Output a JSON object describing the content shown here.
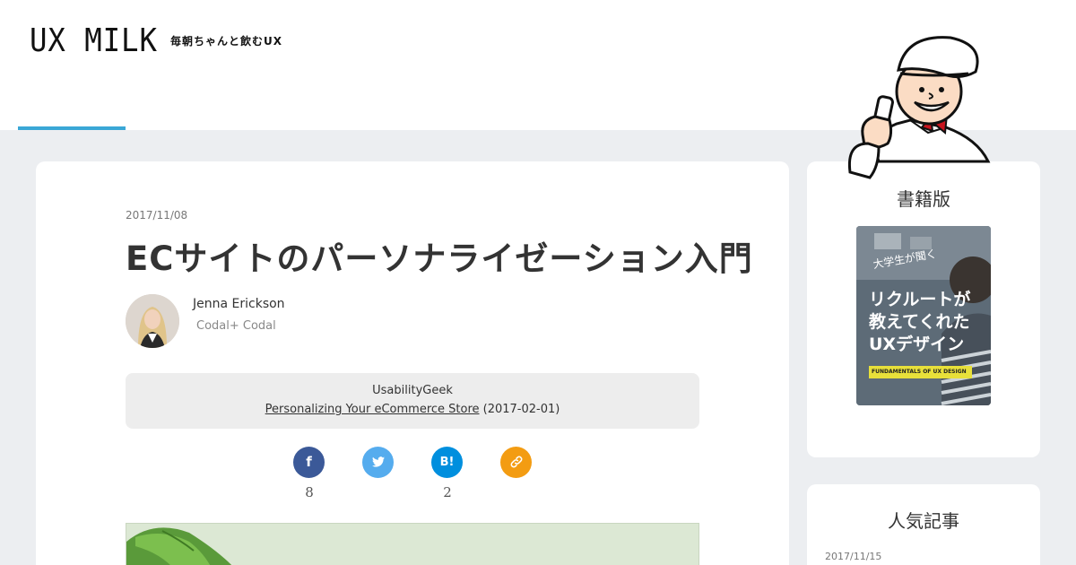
{
  "header": {
    "logo": "UX MILK",
    "tagline": "毎朝ちゃんと飲むUX"
  },
  "article": {
    "date": "2017/11/08",
    "title": "ECサイトのパーソナライゼーション入門",
    "author": {
      "name": "Jenna Erickson",
      "org": "Codal+ Codal"
    },
    "source": {
      "name": "UsabilityGeek",
      "link_text": "Personalizing Your eCommerce Store",
      "date": "(2017-02-01)"
    }
  },
  "share": {
    "facebook": {
      "icon": "f",
      "count": "8"
    },
    "twitter": {
      "icon": "✓",
      "count": ""
    },
    "hatena": {
      "icon": "B!",
      "count": "2"
    },
    "link": {
      "icon": "🔗",
      "count": ""
    }
  },
  "sidebar": {
    "book_heading": "書籍版",
    "book": {
      "subtitle": "大学生が聞く",
      "title": "リクルートが\n教えてくれた\nUXデザイン",
      "label": "FUNDAMENTALS OF UX DESIGN"
    },
    "ranking_heading": "人気記事",
    "ranking_date": "2017/11/15"
  },
  "colors": {
    "accent": "#3aa7d6",
    "facebook": "#3b5998",
    "twitter": "#55acee",
    "hatena": "#008fde",
    "link": "#f39c12"
  }
}
